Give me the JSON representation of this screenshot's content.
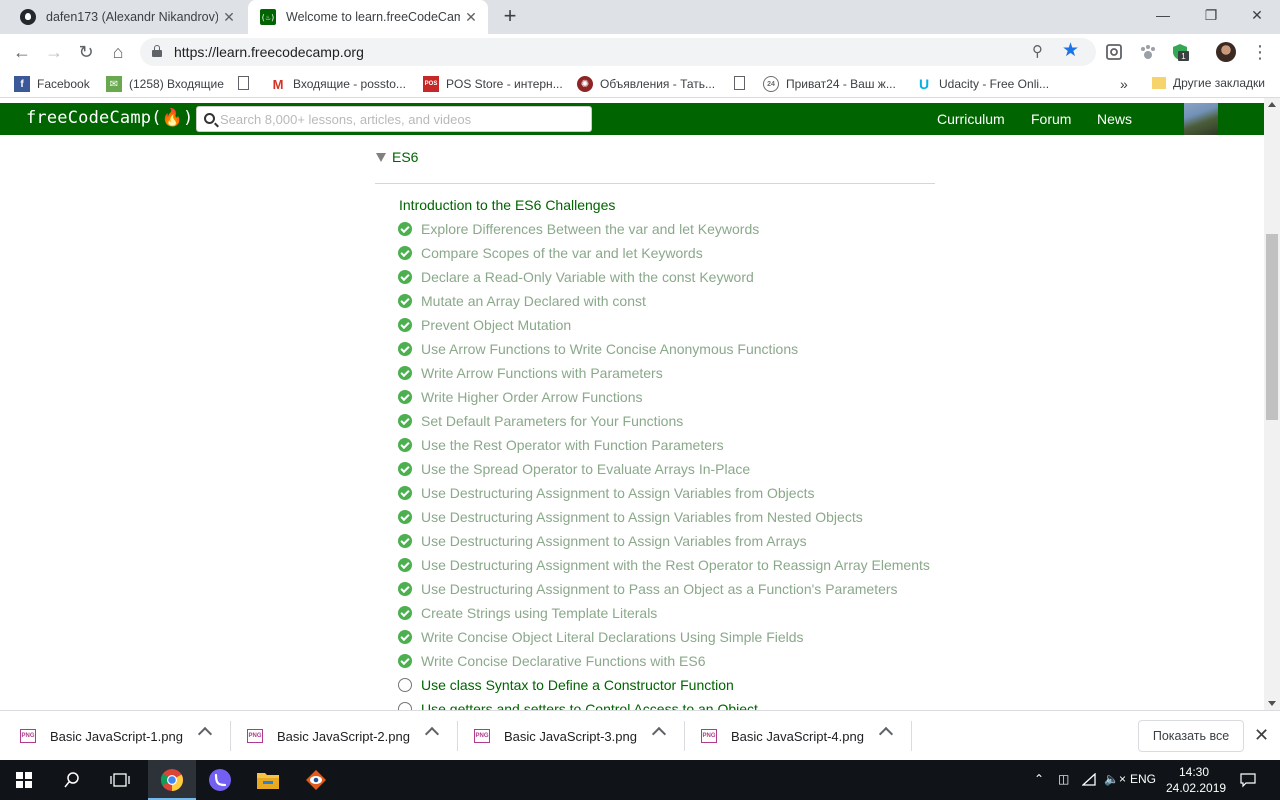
{
  "browser": {
    "tabs": [
      {
        "title": "dafen173 (Alexandr Nikandrov)",
        "active": false
      },
      {
        "title": "Welcome to learn.freeCodeCamp",
        "active": true
      }
    ],
    "url": "https://learn.freecodecamp.org",
    "new_tab_symbol": "+",
    "close_symbol": "✕",
    "bookmarks": [
      {
        "label": "Facebook",
        "icon": "facebook-icon",
        "color": "#3b5998"
      },
      {
        "label": "(1258) Входящие",
        "icon": "mail-icon",
        "color": "#6aa84f"
      },
      {
        "label": "",
        "icon": "page-icon"
      },
      {
        "label": "Входящие - possto...",
        "icon": "gmail-icon",
        "color": "#d93025"
      },
      {
        "label": "POS Store - интерн...",
        "icon": "pos-icon",
        "color": "#c62828"
      },
      {
        "label": "Объявления - Тать...",
        "icon": "ads-icon",
        "color": "#8e2424"
      },
      {
        "label": "",
        "icon": "page-icon"
      },
      {
        "label": "Приват24 - Ваш ж...",
        "icon": "privat-icon",
        "color": "#6d6d6d"
      },
      {
        "label": "Udacity - Free Onli...",
        "icon": "udacity-icon",
        "color": "#02b3e4"
      }
    ],
    "bookmarks_more": "»",
    "other_bookmarks": "Другие закладки",
    "extension_badge": "1"
  },
  "site": {
    "logo": "freeCodeCamp(🔥)",
    "search_placeholder": "Search 8,000+ lessons, articles, and videos",
    "nav": [
      "Curriculum",
      "Forum",
      "News"
    ]
  },
  "curriculum": {
    "section": "ES6",
    "intro": "Introduction to the ES6 Challenges",
    "challenges": [
      {
        "title": "Explore Differences Between the var and let Keywords",
        "completed": true
      },
      {
        "title": "Compare Scopes of the var and let Keywords",
        "completed": true
      },
      {
        "title": "Declare a Read-Only Variable with the const Keyword",
        "completed": true
      },
      {
        "title": "Mutate an Array Declared with const",
        "completed": true
      },
      {
        "title": "Prevent Object Mutation",
        "completed": true
      },
      {
        "title": "Use Arrow Functions to Write Concise Anonymous Functions",
        "completed": true
      },
      {
        "title": "Write Arrow Functions with Parameters",
        "completed": true
      },
      {
        "title": "Write Higher Order Arrow Functions",
        "completed": true
      },
      {
        "title": "Set Default Parameters for Your Functions",
        "completed": true
      },
      {
        "title": "Use the Rest Operator with Function Parameters",
        "completed": true
      },
      {
        "title": "Use the Spread Operator to Evaluate Arrays In-Place",
        "completed": true
      },
      {
        "title": "Use Destructuring Assignment to Assign Variables from Objects",
        "completed": true
      },
      {
        "title": "Use Destructuring Assignment to Assign Variables from Nested Objects",
        "completed": true
      },
      {
        "title": "Use Destructuring Assignment to Assign Variables from Arrays",
        "completed": true
      },
      {
        "title": "Use Destructuring Assignment with the Rest Operator to Reassign Array Elements",
        "completed": true
      },
      {
        "title": "Use Destructuring Assignment to Pass an Object as a Function's Parameters",
        "completed": true
      },
      {
        "title": "Create Strings using Template Literals",
        "completed": true
      },
      {
        "title": "Write Concise Object Literal Declarations Using Simple Fields",
        "completed": true
      },
      {
        "title": "Write Concise Declarative Functions with ES6",
        "completed": true
      },
      {
        "title": "Use class Syntax to Define a Constructor Function",
        "completed": false
      },
      {
        "title": "Use getters and setters to Control Access to an Object",
        "completed": false
      }
    ]
  },
  "downloads": {
    "items": [
      "Basic JavaScript-1.png",
      "Basic JavaScript-2.png",
      "Basic JavaScript-3.png",
      "Basic JavaScript-4.png"
    ],
    "file_badge": "PNG",
    "show_all": "Показать все",
    "close_symbol": "✕"
  },
  "taskbar": {
    "language": "ENG",
    "time": "14:30",
    "date": "24.02.2019"
  },
  "colors": {
    "fcc_green": "#006400",
    "completed_check": "#4caf50",
    "completed_text": "#8aa88a"
  }
}
